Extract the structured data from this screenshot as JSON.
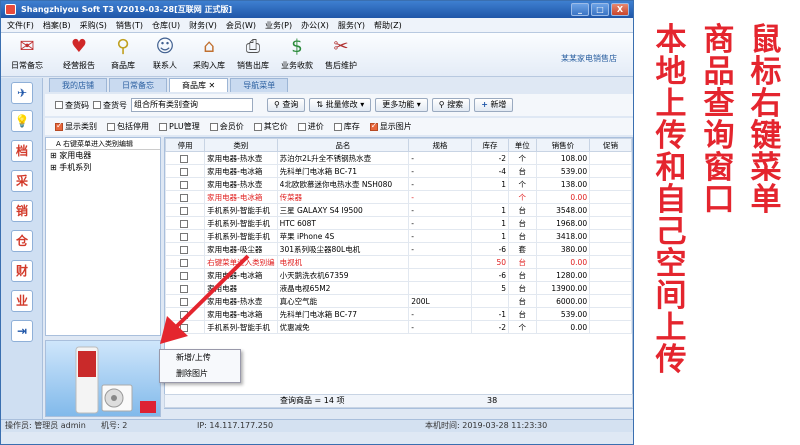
{
  "window": {
    "title": "Shangzhiyou Soft T3 V2019-03-28[互联网 正式版]",
    "controls": [
      "_",
      "□",
      "X"
    ]
  },
  "menu": [
    "文件(F)",
    "档案(B)",
    "采购(S)",
    "销售(T)",
    "仓库(U)",
    "财务(V)",
    "会员(W)",
    "业务(P)",
    "办公(X)",
    "服务(Y)",
    "帮助(Z)"
  ],
  "toolbar": {
    "buttons": [
      {
        "label": "日常备忘",
        "icon": "mail-icon"
      },
      {
        "label": "经营报告",
        "icon": "heart-chart-icon"
      },
      {
        "label": "商品库",
        "icon": "magnifier-icon"
      },
      {
        "label": "联系人",
        "icon": "contacts-icon"
      },
      {
        "label": "采购入库",
        "icon": "house-icon"
      },
      {
        "label": "销售出库",
        "icon": "printer-icon"
      },
      {
        "label": "业务收款",
        "icon": "dollar-icon"
      },
      {
        "label": "售后维护",
        "icon": "tools-icon"
      }
    ],
    "shop_name": "某某家电销售店"
  },
  "sidebar": {
    "buttons": [
      {
        "glyph": "✈",
        "icon": "airplane-icon"
      },
      {
        "glyph": "💡",
        "icon": "bulb-icon"
      },
      {
        "glyph": "档",
        "icon": "archive-icon"
      },
      {
        "glyph": "采",
        "icon": "purchase-icon"
      },
      {
        "glyph": "销",
        "icon": "sales-icon"
      },
      {
        "glyph": "仓",
        "icon": "warehouse-icon"
      },
      {
        "glyph": "财",
        "icon": "finance-icon"
      },
      {
        "glyph": "业",
        "icon": "business-icon"
      },
      {
        "glyph": "⇥",
        "icon": "exit-icon"
      }
    ]
  },
  "tabs": [
    "我的店铺",
    "日常备忘",
    "商品库",
    "导航菜单"
  ],
  "filters": {
    "row1": {
      "chk_search_code": "查货码",
      "chk_search_no": "查货号",
      "search_value": "组合所有类别查询",
      "query_btn": "查询",
      "batch_btn": "批量修改",
      "more_btn": "更多功能",
      "search_btn": "搜索",
      "add_btn": "新增"
    },
    "row2": [
      {
        "label": "显示类别",
        "checked": true
      },
      {
        "label": "包括停用",
        "checked": false
      },
      {
        "label": "PLU管理",
        "checked": false
      },
      {
        "label": "会员价",
        "checked": false
      },
      {
        "label": "其它价",
        "checked": false
      },
      {
        "label": "进价",
        "checked": false
      },
      {
        "label": "库存",
        "checked": false
      },
      {
        "label": "显示图片",
        "checked": true
      }
    ]
  },
  "tree": {
    "header": "A 右键菜单进入类别编辑",
    "nodes": [
      "家用电器",
      "手机系列"
    ]
  },
  "grid": {
    "columns": [
      "停用",
      "类别",
      "品名",
      "规格",
      "库存",
      "单位",
      "销售价",
      "促销"
    ],
    "rows": [
      {
        "cat": "家用电器-热水壶",
        "name": "苏泊尔2L升全不锈钢热水壶",
        "spec": "-",
        "stock": "-2",
        "unit": "个",
        "price": "108.00",
        "red": false
      },
      {
        "cat": "家用电器-电冰箱",
        "name": "先科单门电冰箱 BC-71",
        "spec": "-",
        "stock": "-4",
        "unit": "台",
        "price": "539.00",
        "red": false
      },
      {
        "cat": "家用电器-热水壶",
        "name": "4北欧欧慕迷你电热水壶 NSH080",
        "spec": "-",
        "stock": "1",
        "unit": "个",
        "price": "138.00",
        "red": false
      },
      {
        "cat": "家用电器-电冰箱",
        "name": "传菜器",
        "spec": "-",
        "stock": "",
        "unit": "个",
        "price": "0.00",
        "red": true
      },
      {
        "cat": "手机系列-智能手机",
        "name": "三星 GALAXY S4 I9500",
        "spec": "-",
        "stock": "1",
        "unit": "台",
        "price": "3548.00",
        "red": false
      },
      {
        "cat": "手机系列-智能手机",
        "name": "HTC 608T",
        "spec": "-",
        "stock": "1",
        "unit": "台",
        "price": "1968.00",
        "red": false
      },
      {
        "cat": "手机系列-智能手机",
        "name": "苹果 iPhone 4S",
        "spec": "-",
        "stock": "1",
        "unit": "台",
        "price": "3418.00",
        "red": false
      },
      {
        "cat": "家用电器-吸尘器",
        "name": "301系列吸尘器80L电机",
        "spec": "-",
        "stock": "-6",
        "unit": "套",
        "price": "380.00",
        "red": false
      },
      {
        "cat": "右键菜单进入类别编",
        "name": "电视机",
        "spec": "",
        "stock": "50",
        "unit": "台",
        "price": "0.00",
        "red": true
      },
      {
        "cat": "家用电器-电冰箱",
        "name": "小天鹅洗衣机67359",
        "spec": "",
        "stock": "-6",
        "unit": "台",
        "price": "1280.00",
        "red": false
      },
      {
        "cat": "家用电器",
        "name": "液晶电视65M2",
        "spec": "",
        "stock": "5",
        "unit": "台",
        "price": "13900.00",
        "red": false
      },
      {
        "cat": "家用电器-热水壶",
        "name": "真心空气能",
        "spec": "200L",
        "stock": "",
        "unit": "台",
        "price": "6000.00",
        "red": false
      },
      {
        "cat": "家用电器-电冰箱",
        "name": "先科单门电冰箱 BC-77",
        "spec": "-",
        "stock": "-1",
        "unit": "台",
        "price": "539.00",
        "red": false
      },
      {
        "cat": "手机系列-智能手机",
        "name": "优惠减免",
        "spec": "-",
        "stock": "-2",
        "unit": "个",
        "price": "0.00",
        "red": false
      }
    ],
    "footer_label": "查询商品 = 14 项",
    "footer_total": "38"
  },
  "context_menu": [
    "新增/上传",
    "删除图片"
  ],
  "status": {
    "operator": "操作员: 管理员 admin",
    "machine": "机号: 2",
    "ip": "IP: 14.117.177.250",
    "time": "本机时间: 2019-03-28 11:23:30"
  },
  "annotations": {
    "col1": "本地上传和自己空间上传",
    "col2": "商品查询窗口",
    "col3": "鼠标右键菜单"
  },
  "colors": {
    "annotation": "#e4252e",
    "titlebar": "#1f56a8",
    "arrow": "#e4252e"
  }
}
